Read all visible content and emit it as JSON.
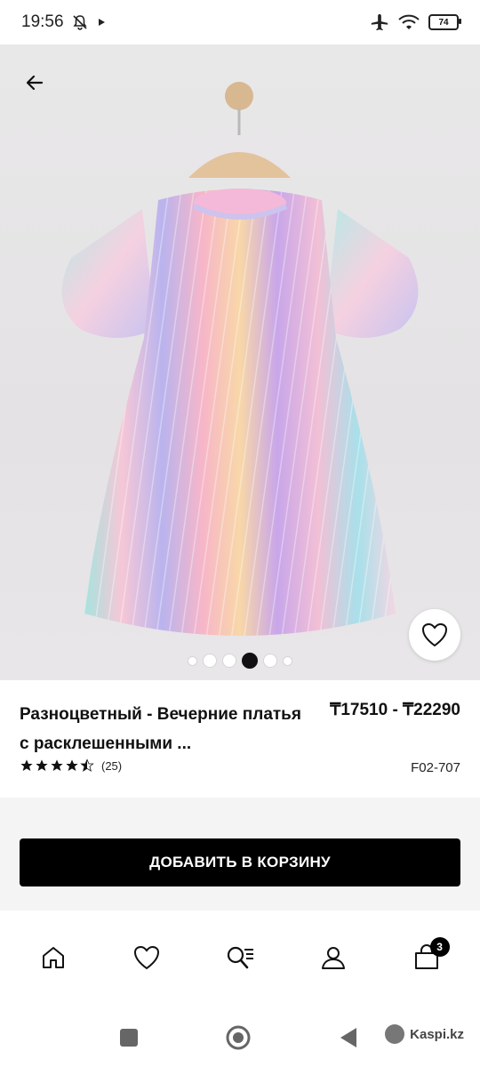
{
  "status": {
    "time": "19:56",
    "battery": "74"
  },
  "product": {
    "title": "Разноцветный - Вечерние платья с расклешенными ...",
    "price": "₸17510 - ₸22290",
    "rating_value": 4.5,
    "review_count": "(25)",
    "sku": "F02-707",
    "slides_total": 6,
    "slide_active": 4
  },
  "actions": {
    "add_to_cart": "ДОБАВИТЬ В КОРЗИНУ"
  },
  "nav": {
    "cart_badge": "3"
  },
  "watermark": {
    "text": "Kaspi.kz"
  },
  "icons": [
    "back-arrow-icon",
    "heart-icon",
    "home-icon",
    "favorites-icon",
    "search-list-icon",
    "profile-icon",
    "cart-icon",
    "silent-icon",
    "play-icon",
    "airplane-icon",
    "wifi-icon",
    "battery-icon"
  ]
}
